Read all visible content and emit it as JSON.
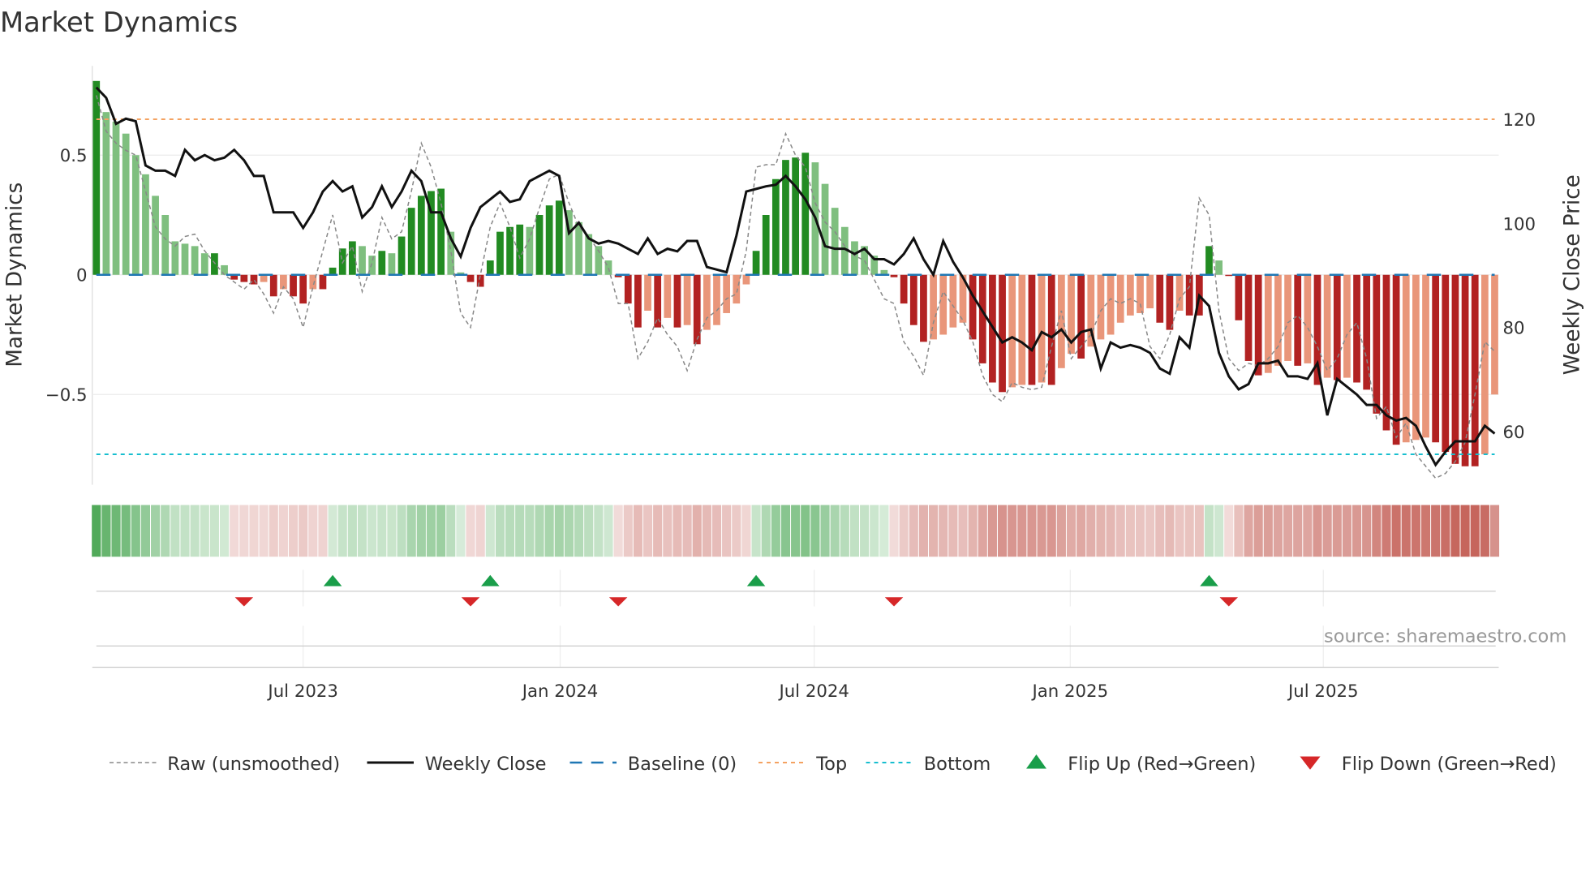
{
  "title": "Market Dynamics",
  "source": "source: sharemaestro.com",
  "colors": {
    "up_strong": "#228b22",
    "up_weak": "#7fbf7f",
    "down_strong": "#b22222",
    "down_weak": "#e9967a",
    "close": "#111111",
    "raw": "#888888",
    "baseline": "#1f77b4",
    "top": "#f4a261",
    "bottom": "#17becf",
    "flip_up": "#1a9e4a",
    "flip_down": "#d62728"
  },
  "chart_data": {
    "type": "bar",
    "title": "Market Dynamics",
    "ylabel": "Market Dynamics",
    "y2label": "Weekly Close Price",
    "ylim": [
      -0.87,
      0.83
    ],
    "y2lim": [
      50.5,
      133.5
    ],
    "yticks": [
      {
        "v": 0.5,
        "label": "0.5"
      },
      {
        "v": 0,
        "label": "0"
      },
      {
        "v": -0.5,
        "label": "−0.5"
      }
    ],
    "y2ticks": [
      {
        "v": 120,
        "label": "120"
      },
      {
        "v": 100,
        "label": "100"
      },
      {
        "v": 80,
        "label": "80"
      },
      {
        "v": 60,
        "label": "60"
      }
    ],
    "xticks": [
      {
        "week": 21,
        "label": "Jul 2023"
      },
      {
        "week": 47.1,
        "label": "Jan 2024"
      },
      {
        "week": 72.9,
        "label": "Jul 2024"
      },
      {
        "week": 98.9,
        "label": "Jan 2025"
      },
      {
        "week": 124.6,
        "label": "Jul 2025"
      }
    ],
    "top_level": 0.65,
    "bottom_level": -0.75,
    "baseline": 0,
    "momentum": [
      0.81,
      0.68,
      0.64,
      0.59,
      0.5,
      0.42,
      0.33,
      0.25,
      0.14,
      0.13,
      0.12,
      0.09,
      0.09,
      0.04,
      -0.02,
      -0.03,
      -0.04,
      -0.03,
      -0.09,
      -0.06,
      -0.09,
      -0.12,
      -0.06,
      -0.06,
      0.03,
      0.11,
      0.14,
      0.12,
      0.08,
      0.1,
      0.09,
      0.16,
      0.28,
      0.33,
      0.35,
      0.36,
      0.18,
      0.01,
      -0.03,
      -0.05,
      0.06,
      0.18,
      0.2,
      0.21,
      0.2,
      0.25,
      0.29,
      0.31,
      0.27,
      0.22,
      0.17,
      0.12,
      0.06,
      -0.01,
      -0.12,
      -0.22,
      -0.15,
      -0.22,
      -0.18,
      -0.22,
      -0.21,
      -0.29,
      -0.23,
      -0.21,
      -0.16,
      -0.12,
      -0.04,
      0.1,
      0.25,
      0.4,
      0.48,
      0.49,
      0.51,
      0.47,
      0.38,
      0.28,
      0.2,
      0.14,
      0.12,
      0.08,
      0.02,
      -0.01,
      -0.12,
      -0.21,
      -0.28,
      -0.27,
      -0.25,
      -0.22,
      -0.2,
      -0.27,
      -0.37,
      -0.45,
      -0.49,
      -0.47,
      -0.46,
      -0.46,
      -0.45,
      -0.46,
      -0.39,
      -0.33,
      -0.35,
      -0.3,
      -0.27,
      -0.25,
      -0.2,
      -0.17,
      -0.16,
      -0.14,
      -0.2,
      -0.23,
      -0.15,
      -0.17,
      -0.17,
      0.12,
      0.06,
      -0.005,
      -0.19,
      -0.36,
      -0.42,
      -0.41,
      -0.38,
      -0.36,
      -0.38,
      -0.37,
      -0.46,
      -0.43,
      -0.44,
      -0.43,
      -0.45,
      -0.48,
      -0.58,
      -0.65,
      -0.71,
      -0.7,
      -0.69,
      -0.68,
      -0.7,
      -0.74,
      -0.79,
      -0.8,
      -0.8,
      -0.75,
      -0.5
    ],
    "raw": [
      0.75,
      0.6,
      0.55,
      0.52,
      0.5,
      0.35,
      0.2,
      0.15,
      0.12,
      0.16,
      0.17,
      0.1,
      0.05,
      0.0,
      -0.03,
      -0.06,
      -0.02,
      -0.08,
      -0.16,
      -0.05,
      -0.1,
      -0.22,
      -0.05,
      0.1,
      0.25,
      0.05,
      0.12,
      -0.07,
      0.05,
      0.24,
      0.15,
      0.18,
      0.35,
      0.55,
      0.45,
      0.3,
      0.1,
      -0.16,
      -0.22,
      0.0,
      0.2,
      0.3,
      0.2,
      0.07,
      0.15,
      0.28,
      0.4,
      0.42,
      0.3,
      0.2,
      0.16,
      0.1,
      0.03,
      -0.12,
      -0.12,
      -0.35,
      -0.28,
      -0.18,
      -0.25,
      -0.3,
      -0.4,
      -0.27,
      -0.18,
      -0.15,
      -0.1,
      -0.08,
      0.1,
      0.45,
      0.46,
      0.46,
      0.59,
      0.5,
      0.45,
      0.3,
      0.22,
      0.18,
      0.12,
      0.08,
      0.06,
      -0.02,
      -0.1,
      -0.12,
      -0.28,
      -0.34,
      -0.42,
      -0.2,
      -0.07,
      -0.13,
      -0.19,
      -0.28,
      -0.42,
      -0.5,
      -0.53,
      -0.45,
      -0.47,
      -0.48,
      -0.47,
      -0.3,
      -0.15,
      -0.35,
      -0.3,
      -0.25,
      -0.15,
      -0.1,
      -0.12,
      -0.1,
      -0.12,
      -0.3,
      -0.35,
      -0.25,
      -0.1,
      -0.05,
      0.32,
      0.25,
      -0.15,
      -0.35,
      -0.4,
      -0.37,
      -0.38,
      -0.35,
      -0.3,
      -0.2,
      -0.17,
      -0.22,
      -0.3,
      -0.4,
      -0.35,
      -0.25,
      -0.2,
      -0.35,
      -0.6,
      -0.55,
      -0.68,
      -0.62,
      -0.75,
      -0.8,
      -0.85,
      -0.83,
      -0.78,
      -0.7,
      -0.5,
      -0.28,
      -0.32
    ],
    "close": [
      126,
      124,
      119,
      120,
      119.5,
      111,
      110,
      110,
      109,
      114,
      112,
      113,
      112,
      112.5,
      114,
      112,
      109,
      109,
      102,
      102,
      102,
      99,
      102,
      106,
      108,
      106,
      107,
      101,
      103,
      107,
      103,
      106,
      110,
      108,
      102,
      102,
      97,
      93.5,
      99,
      103,
      104.5,
      106,
      104,
      104.5,
      108,
      109,
      110,
      109,
      98,
      100,
      97,
      96,
      96.5,
      96,
      95,
      94,
      97,
      94,
      95,
      94.5,
      96.5,
      96.5,
      91.5,
      91,
      90.5,
      97.5,
      106,
      106.5,
      107,
      107.3,
      109,
      107,
      104.5,
      101,
      95.5,
      95,
      95,
      94,
      95,
      93,
      93,
      92,
      94,
      97,
      93,
      90,
      96.5,
      92.5,
      89.5,
      86,
      83,
      80,
      77,
      78,
      77,
      75.5,
      79,
      78,
      79.5,
      77,
      79,
      79.5,
      72,
      77,
      76,
      76.5,
      76,
      75,
      72,
      71,
      78,
      76,
      86,
      84,
      75,
      70.5,
      68,
      69,
      73,
      73,
      73.5,
      70.5,
      70.5,
      70,
      73,
      63,
      70,
      68.5,
      67,
      65,
      65,
      63,
      62,
      62.5,
      61,
      57,
      53.5,
      56,
      58,
      58,
      58,
      61,
      59.5
    ],
    "flip_up_weeks": [
      24,
      40,
      67,
      113
    ],
    "flip_down_weeks": [
      15,
      38,
      53,
      81,
      115
    ]
  },
  "legend": [
    {
      "key": "raw",
      "label": "Raw (unsmoothed)"
    },
    {
      "key": "close",
      "label": "Weekly Close"
    },
    {
      "key": "baseline",
      "label": "Baseline (0)"
    },
    {
      "key": "top",
      "label": "Top"
    },
    {
      "key": "bottom",
      "label": "Bottom"
    },
    {
      "key": "flip_up",
      "label": "Flip Up (Red→Green)"
    },
    {
      "key": "flip_down",
      "label": "Flip Down (Green→Red)"
    }
  ]
}
